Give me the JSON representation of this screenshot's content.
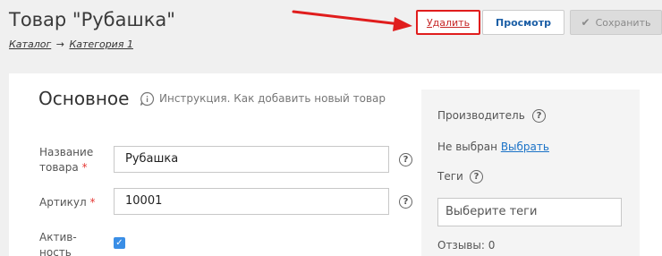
{
  "header": {
    "title": "Товар \"Рубашка\"",
    "breadcrumb": {
      "catalog": "Каталог",
      "separator": "→",
      "category": "Категория 1"
    }
  },
  "toolbar": {
    "delete_label": "Удалить",
    "view_label": "Просмотр",
    "save_label": "Сохранить",
    "save_icon": "check-icon"
  },
  "main": {
    "section_title": "Основное",
    "help_text": "Инструкция. Как добавить новый товар",
    "fields": {
      "name_label": "Название товара",
      "name_value": "Рубашка",
      "sku_label": "Артикул",
      "sku_value": "10001",
      "active_label": "Актив- ность",
      "required_marker": "*"
    }
  },
  "sidebar": {
    "manufacturer_label": "Производитель",
    "manufacturer_value": "Не выбран",
    "manufacturer_link": "Выбрать",
    "tags_label": "Теги",
    "tags_placeholder": "Выберите теги",
    "reviews_label": "Отзывы: 0"
  },
  "colors": {
    "accent_link": "#1c73c7",
    "delete_red": "#c62828",
    "highlight_box": "#e01d1d",
    "checkbox": "#3a8ee6"
  }
}
